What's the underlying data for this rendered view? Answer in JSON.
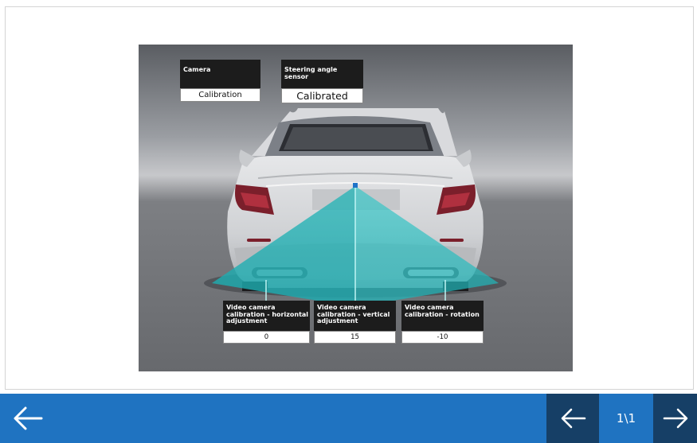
{
  "scene": {
    "camera": {
      "label": "Camera",
      "value": "Calibration"
    },
    "steering": {
      "label": "Steering angle sensor",
      "value": "Calibrated"
    },
    "horizontal": {
      "label": "Video camera calibration  - horizontal adjustment",
      "value": "0"
    },
    "vertical": {
      "label": "Video camera calibration  - vertical adjustment",
      "value": "15"
    },
    "rotation": {
      "label": "Video camera calibration  - rotation",
      "value": "-10"
    }
  },
  "nav": {
    "page_indicator": "1\\1",
    "back_icon": "arrow-left-icon",
    "prev_icon": "arrow-left-icon",
    "next_icon": "arrow-right-icon"
  },
  "colors": {
    "bottom_bar": "#1f73c1",
    "nav_button": "#163f66",
    "camera_beam": "#2ec8c8"
  }
}
